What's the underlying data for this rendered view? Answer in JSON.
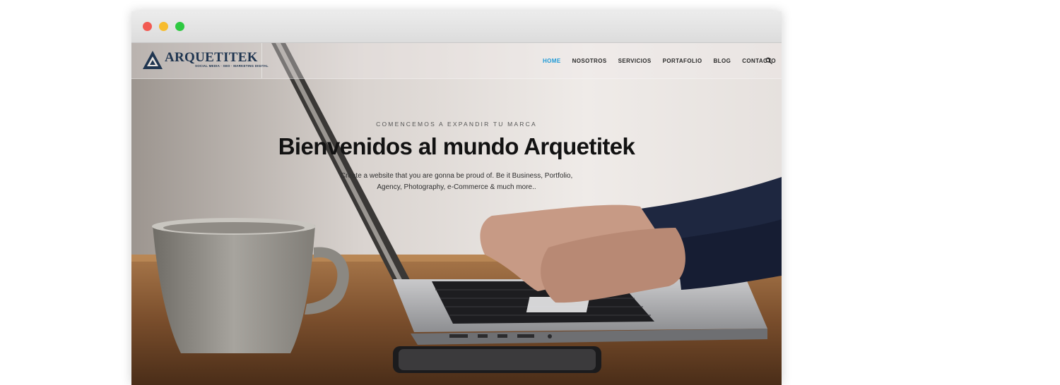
{
  "brand": {
    "name": "ARQUETITEK",
    "tagline": "SOCIAL MEDIA · SEO · MARKETING DIGITAL"
  },
  "nav": {
    "items": [
      {
        "label": "HOME",
        "active": true
      },
      {
        "label": "NOSOTROS",
        "active": false
      },
      {
        "label": "SERVICIOS",
        "active": false
      },
      {
        "label": "PORTAFOLIO",
        "active": false
      },
      {
        "label": "BLOG",
        "active": false
      },
      {
        "label": "CONTACTO",
        "active": false
      }
    ],
    "search_icon": "search-icon"
  },
  "hero": {
    "kicker": "COMENCEMOS A EXPANDIR TU MARCA",
    "title": "Bienvenidos al mundo Arquetitek",
    "description": "Create a website that you are gonna be proud of. Be it Business, Portfolio, Agency, Photography, e-Commerce & much more.."
  },
  "colors": {
    "accent": "#1f9ad6",
    "brand": "#1f3550",
    "window_close": "#f25a52",
    "window_minimize": "#f7bc2e",
    "window_maximize": "#2ec941"
  }
}
